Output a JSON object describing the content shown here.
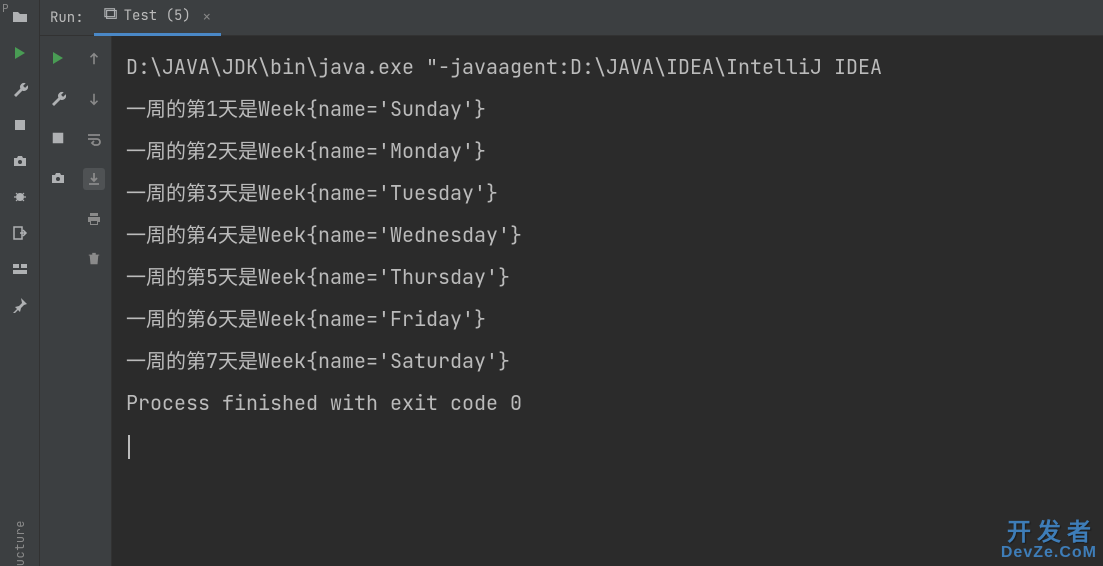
{
  "left_gutter": {
    "vertical_label_top": "P",
    "vertical_label_bottom": "ucture"
  },
  "tab_bar": {
    "run_label": "Run:",
    "tab_label": "Test (5)"
  },
  "console": {
    "lines": [
      "D:\\JAVA\\JDK\\bin\\java.exe \"-javaagent:D:\\JAVA\\IDEA\\IntelliJ IDEA ",
      "一周的第1天是Week{name='Sunday'}",
      "一周的第2天是Week{name='Monday'}",
      "一周的第3天是Week{name='Tuesday'}",
      "一周的第4天是Week{name='Wednesday'}",
      "一周的第5天是Week{name='Thursday'}",
      "一周的第6天是Week{name='Friday'}",
      "一周的第7天是Week{name='Saturday'}",
      "",
      "Process finished with exit code 0"
    ]
  },
  "watermark": {
    "top": "开发者",
    "bottom": "DevZe.CoM"
  }
}
